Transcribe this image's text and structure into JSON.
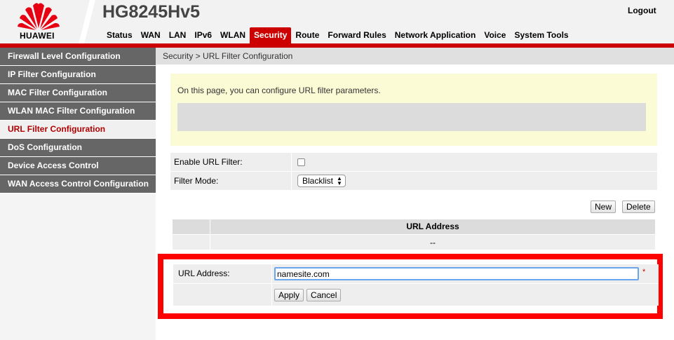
{
  "header": {
    "brand": "HUAWEI",
    "model": "HG8245Hv5",
    "logout_label": "Logout",
    "brand_color": "#cc0000"
  },
  "nav": {
    "items": [
      "Status",
      "WAN",
      "LAN",
      "IPv6",
      "WLAN",
      "Security",
      "Route",
      "Forward Rules",
      "Network Application",
      "Voice",
      "System Tools"
    ],
    "active": "Security"
  },
  "sidebar": {
    "items": [
      {
        "label": "Firewall Level Configuration"
      },
      {
        "label": "IP Filter Configuration"
      },
      {
        "label": "MAC Filter Configuration"
      },
      {
        "label": "WLAN MAC Filter Configuration"
      },
      {
        "label": "URL Filter Configuration"
      },
      {
        "label": "DoS Configuration"
      },
      {
        "label": "Device Access Control"
      },
      {
        "label": "WAN Access Control Configuration"
      }
    ],
    "active": "URL Filter Configuration"
  },
  "main": {
    "breadcrumb": "Security > URL Filter Configuration",
    "info_text": "On this page, you can configure URL filter parameters.",
    "form": {
      "enable_label": "Enable URL Filter:",
      "enable_checked": false,
      "mode_label": "Filter Mode:",
      "mode_value": "Blacklist"
    },
    "buttons": {
      "new_label": "New",
      "delete_label": "Delete"
    },
    "list": {
      "header": "URL Address",
      "empty_cell": "--"
    },
    "editor": {
      "url_label": "URL Address:",
      "url_value": "namesite.com",
      "required_mark": "*",
      "apply_label": "Apply",
      "cancel_label": "Cancel",
      "highlight_color": "#ff0000"
    }
  }
}
